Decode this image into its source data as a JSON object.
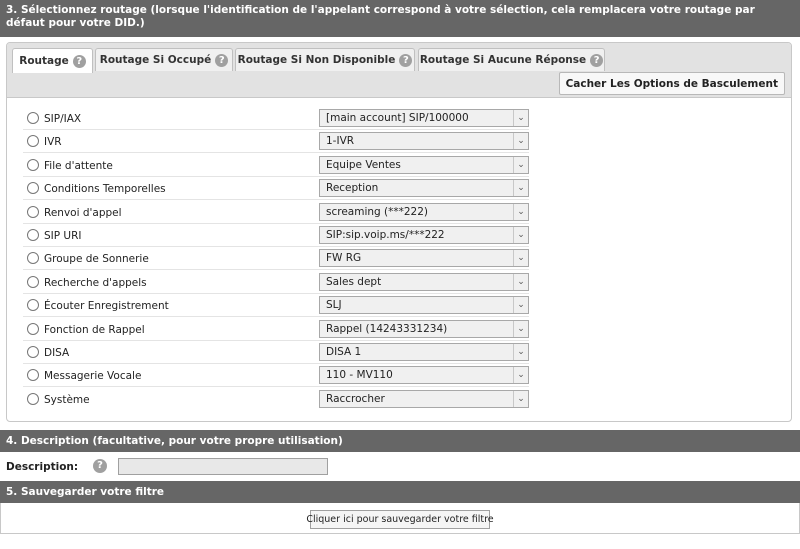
{
  "section3": {
    "title": "3. Sélectionnez routage (lorsque l'identification de l'appelant correspond à votre sélection, cela remplacera votre routage par défaut pour votre DID.)"
  },
  "tabs": [
    {
      "label": "Routage",
      "active": true
    },
    {
      "label": "Routage Si Occupé",
      "active": false
    },
    {
      "label": "Routage Si Non Disponible",
      "active": false
    },
    {
      "label": "Routage Si Aucune Réponse",
      "active": false
    }
  ],
  "help_glyph": "?",
  "toggle_button": "Cacher Les Options de Basculement",
  "routing_options": [
    {
      "label": "SIP/IAX",
      "value": "[main account] SIP/100000"
    },
    {
      "label": "IVR",
      "value": "1-IVR"
    },
    {
      "label": "File d'attente",
      "value": "Equipe Ventes"
    },
    {
      "label": "Conditions Temporelles",
      "value": "Reception"
    },
    {
      "label": "Renvoi d'appel",
      "value": "screaming (***222)"
    },
    {
      "label": "SIP URI",
      "value": "SIP:sip.voip.ms/***222"
    },
    {
      "label": "Groupe de Sonnerie",
      "value": "FW RG"
    },
    {
      "label": "Recherche d'appels",
      "value": "Sales dept"
    },
    {
      "label": "Écouter Enregistrement",
      "value": "SLJ"
    },
    {
      "label": "Fonction de Rappel",
      "value": "Rappel (14243331234)"
    },
    {
      "label": "DISA",
      "value": "DISA 1"
    },
    {
      "label": "Messagerie Vocale",
      "value": "110 - MV110"
    },
    {
      "label": "Système",
      "value": "Raccrocher"
    }
  ],
  "section4": {
    "title": "4. Description (facultative, pour votre propre utilisation)",
    "label": "Description:",
    "value": ""
  },
  "section5": {
    "title": "5. Sauvegarder votre filtre",
    "button": "Cliquer ici pour sauvegarder votre filtre"
  },
  "colors": {
    "section_header_bg": "#666666",
    "tab_bar_bg": "#e2e2e2",
    "help_icon_bg": "#a0a0a0"
  }
}
